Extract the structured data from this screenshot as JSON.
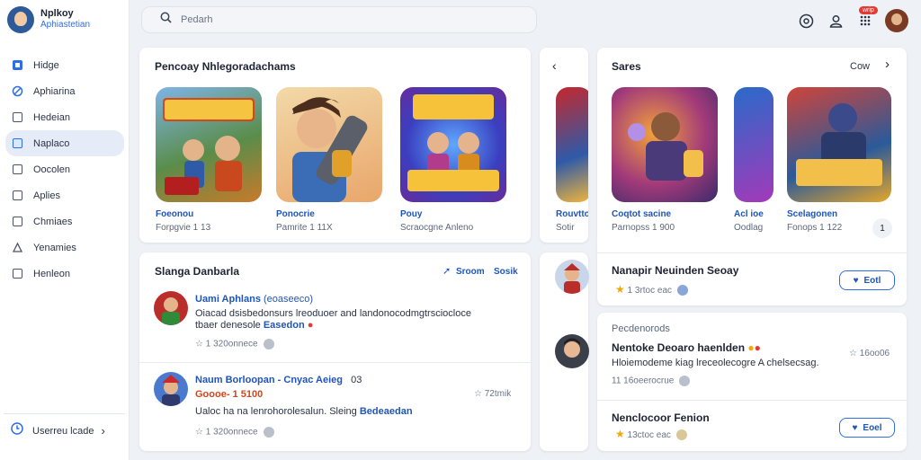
{
  "brand": {
    "name": "Nplkoy",
    "subtitle": "Aphiastetian"
  },
  "sidebar": {
    "items": [
      {
        "label": "Hidge",
        "icon": "home-icon"
      },
      {
        "label": "Aphiarina",
        "icon": "apps-icon"
      },
      {
        "label": "Hedeian",
        "icon": "hidden-icon"
      },
      {
        "label": "Naplaco",
        "icon": "places-icon"
      },
      {
        "label": "Oocolen",
        "icon": "collection-icon"
      },
      {
        "label": "Aplies",
        "icon": "apps-list-icon"
      },
      {
        "label": "Chmiaes",
        "icon": "channels-icon"
      },
      {
        "label": "Yenamies",
        "icon": "games-icon"
      },
      {
        "label": "Henleon",
        "icon": "help-icon"
      }
    ],
    "active_index": 3,
    "footer_label": "Userreu lcade"
  },
  "search": {
    "placeholder": "Pedarh"
  },
  "topbar": {
    "badge": "wrip"
  },
  "featured": {
    "title": "Pencoay Nhlegoradachams",
    "tiles": [
      {
        "name": "Foeonou",
        "meta": "Forpgvie 1 13"
      },
      {
        "name": "Ponocrie",
        "meta": "Pamrite 1 11X"
      },
      {
        "name": "Pouy",
        "meta": "Scraocgne Anleno"
      }
    ],
    "partial_tile": {
      "name": "Rouvtto",
      "meta": "Sotir"
    }
  },
  "sales": {
    "title": "Sares",
    "more": "Cow",
    "tiles": [
      {
        "name": "Coqtot sacine",
        "meta": "Parnopss 1 900"
      },
      {
        "name": "Acl ioe",
        "meta": "Oodlag"
      },
      {
        "name": "Scelagonen",
        "meta": "Fonops 1 122"
      }
    ],
    "count": "1"
  },
  "news": {
    "title": "Slanga Danbarla",
    "link1": "Sroom",
    "link2": "Sosik",
    "posts": [
      {
        "name": "Uami Aphlans",
        "tag": "(eoaseeco)",
        "text1": "Oiacad dsisbedonsurs lreoduoer and landonocodmgtrsciocloce",
        "text2": "tbaer denesole",
        "highlight": "Easedon",
        "meta": "1 320onnece"
      },
      {
        "name": "Naum Borloopan - Cnyac Aeieg",
        "tag": "03",
        "subline": "Goooe- 1 5100",
        "text1": "Ualoc ha na lenrohorolesalun. Sleing",
        "highlight": "Bedeaedan",
        "meta": "1 320onnece",
        "count": "72tmik"
      }
    ]
  },
  "right_feed": {
    "top": {
      "title": "Nanapir Neuinden Seoay",
      "meta": "1 3rtoc eac",
      "button": "Eotl"
    },
    "section_label": "Pecdenorods",
    "item": {
      "title": "Nentoke Deoaro haenlden",
      "text": "Hloiemodeme kiag lreceolecogre A chelsecsag.",
      "meta": "11 16oeerocrue",
      "count": "16oo06"
    },
    "bottom": {
      "title": "Nenclocoor Fenion",
      "meta": "13ctoc eac",
      "button": "Eoel"
    }
  },
  "colors": {
    "accent": "#2f6ee0",
    "link": "#1f55b8",
    "background": "#eef1f5"
  }
}
